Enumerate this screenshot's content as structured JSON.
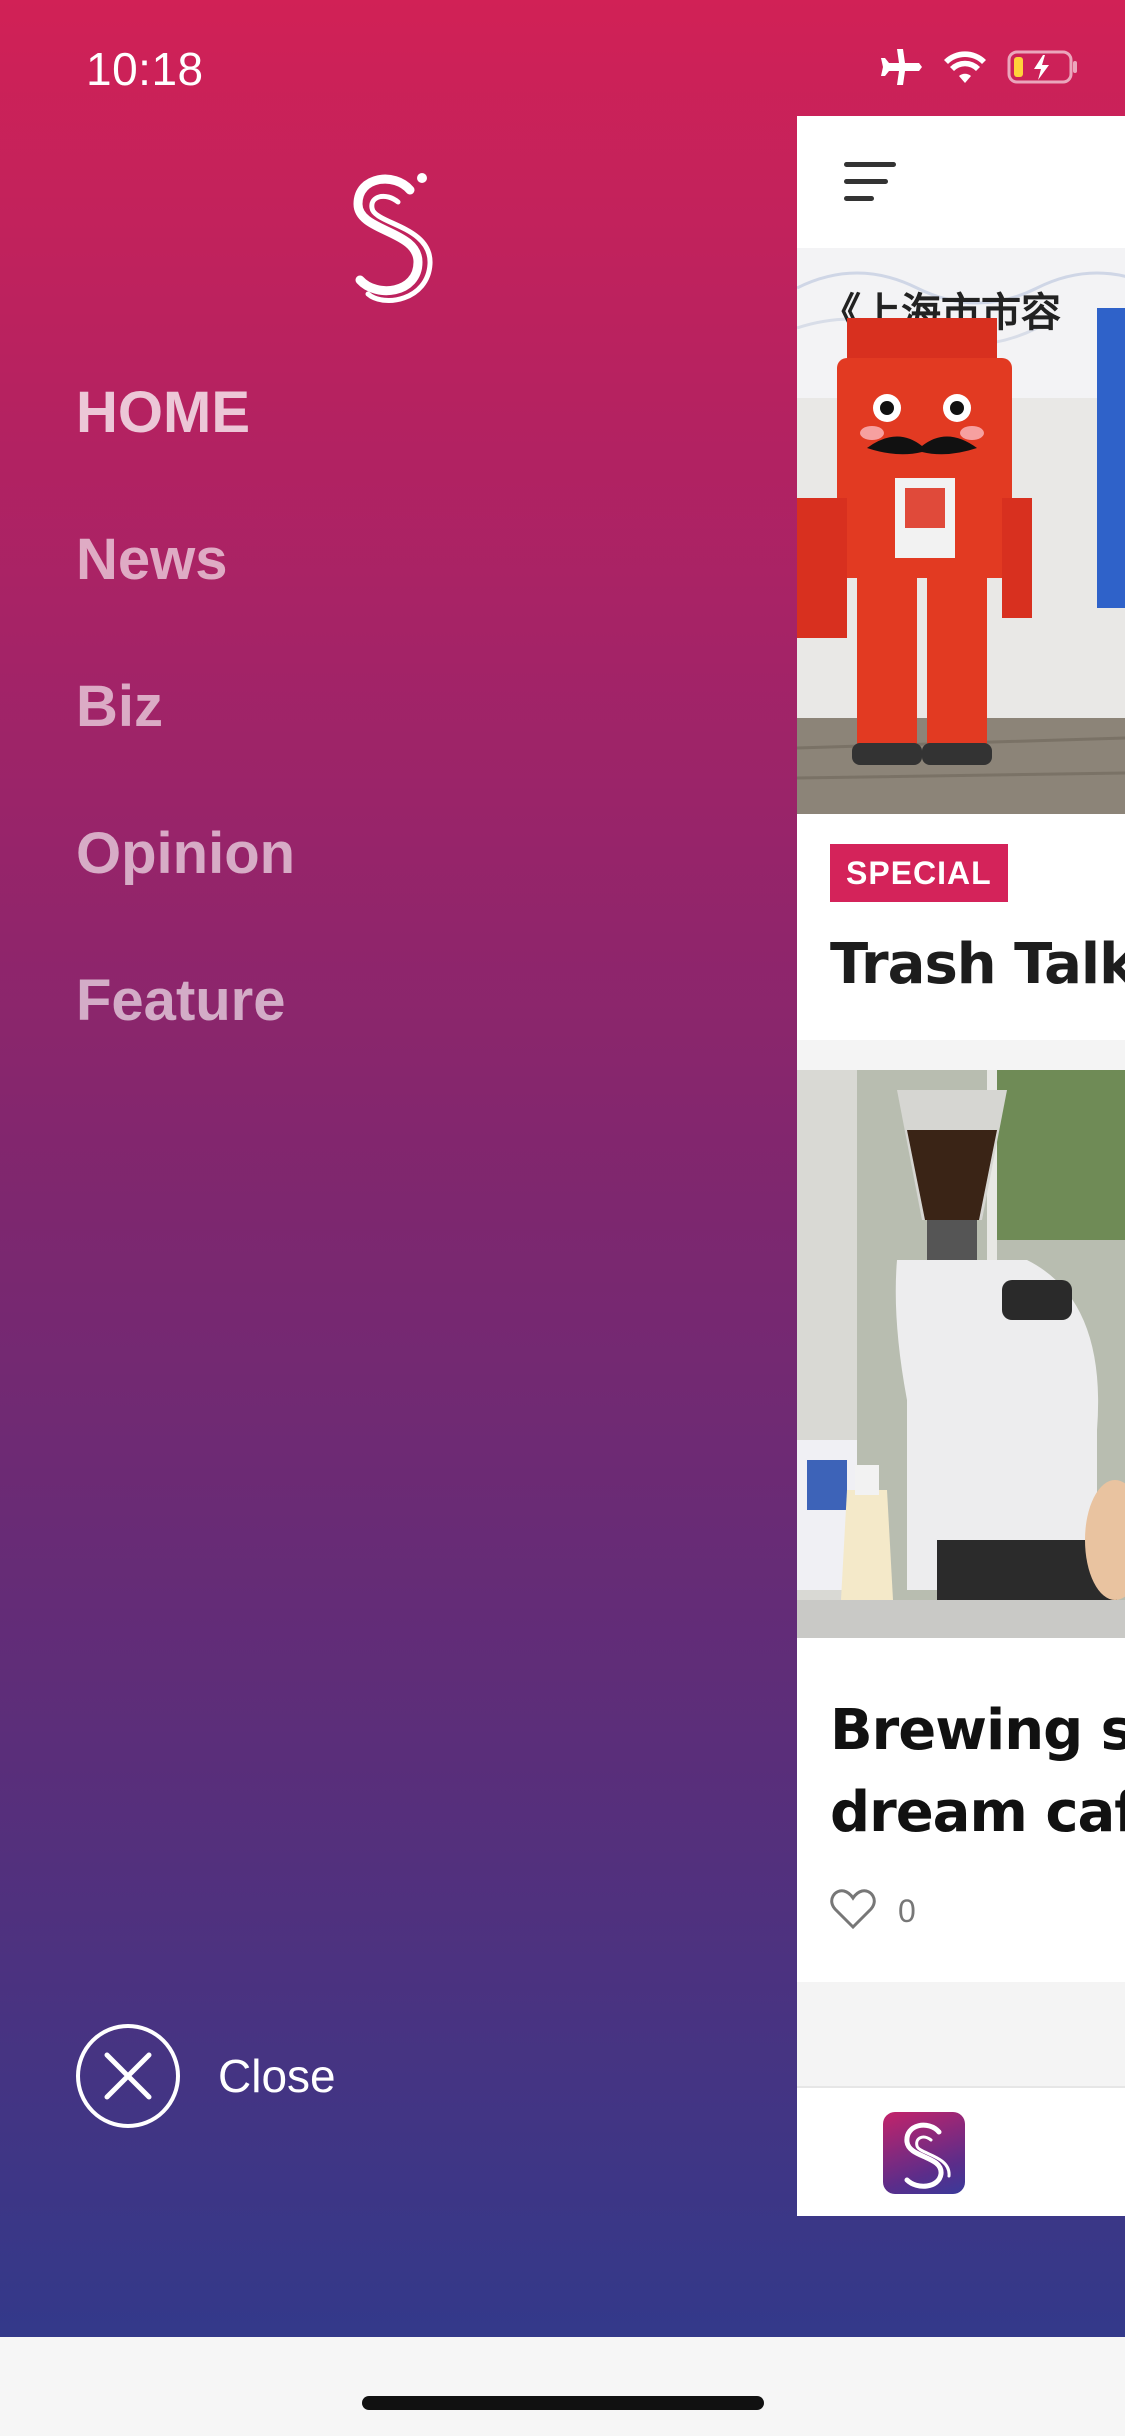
{
  "status_bar": {
    "time": "10:18",
    "icons": [
      "airplane-icon",
      "wifi-icon",
      "battery-charging-icon"
    ]
  },
  "drawer": {
    "logo": "shine-s-logo",
    "menu": [
      {
        "label": "HOME",
        "active": true
      },
      {
        "label": "News",
        "active": false
      },
      {
        "label": "Biz",
        "active": false
      },
      {
        "label": "Opinion",
        "active": false
      },
      {
        "label": "Feature",
        "active": false
      }
    ],
    "close_label": "Close",
    "gradient": [
      "#d12156",
      "#33398a"
    ]
  },
  "content": {
    "card1": {
      "badge": "SPECIAL",
      "title": "Trash Talk",
      "image_sign": "《上海市市容"
    },
    "card2": {
      "title_line1": "Brewing so",
      "title_line2": "dream cafe",
      "likes": "0"
    }
  },
  "colors": {
    "accent": "#d4235a"
  }
}
